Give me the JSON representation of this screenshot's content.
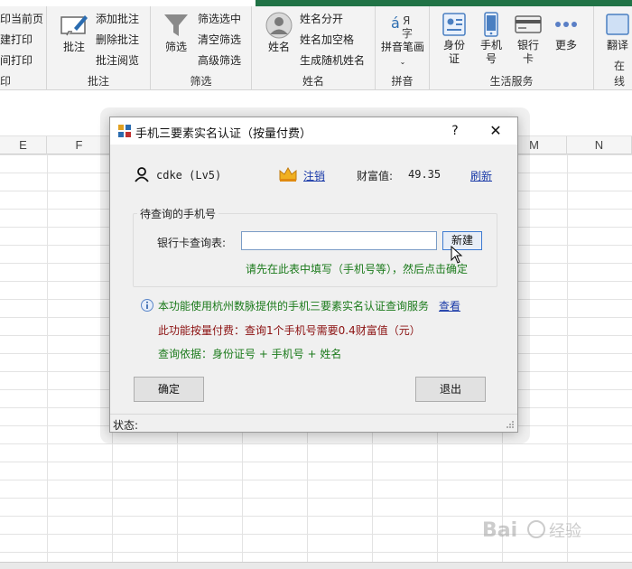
{
  "ribbon": {
    "page_group": {
      "items": [
        "印当前页",
        "建打印",
        "间打印"
      ],
      "label": "印"
    },
    "comment_group": {
      "large_label": "批注",
      "items": [
        "添加批注",
        "删除批注",
        "批注阅览"
      ],
      "label": "批注"
    },
    "filter_group": {
      "large_label": "筛选",
      "items": [
        "筛选选中",
        "清空筛选",
        "高级筛选"
      ],
      "label": "筛选"
    },
    "name_group": {
      "large_label": "姓名",
      "items": [
        "姓名分开",
        "姓名加空格",
        "生成随机姓名"
      ],
      "label": "姓名"
    },
    "pinyin_group": {
      "large_label": "拼音笔画",
      "label": "拼音"
    },
    "life_group": {
      "buttons": [
        "身份证",
        "手机号",
        "银行卡",
        "更多"
      ],
      "label": "生活服务"
    },
    "translate_group": {
      "large_label": "翻译",
      "label": "在线"
    }
  },
  "sheet": {
    "columns": [
      "E",
      "F",
      "M",
      "N"
    ]
  },
  "dialog": {
    "title": "手机三要素实名认证（按量付费）",
    "help": "?",
    "close": "✕",
    "user": {
      "name": "cdke (Lv5)",
      "logout": "注销",
      "wealth_label": "财富值:",
      "wealth_value": "49.35",
      "refresh": "刷新"
    },
    "group_title": "待查询的手机号",
    "field_label": "银行卡查询表:",
    "field_value": "",
    "new_button": "新建",
    "hint": "请先在此表中填写（手机号等），然后点击确定",
    "info": "本功能使用杭州数脉提供的手机三要素实名认证查询服务",
    "view_link": "查看",
    "fee": "此功能按量付费：查询1个手机号需要0.4财富值（元）",
    "basis": "查询依据：身份证号 + 手机号 + 姓名",
    "ok_button": "确定",
    "exit_button": "退出",
    "status_label": "状态:"
  },
  "colors": {
    "excel_green": "#217346",
    "link_blue": "#1a3aa8",
    "hint_green": "#1b7a1b",
    "fee_red": "#8b1010"
  }
}
